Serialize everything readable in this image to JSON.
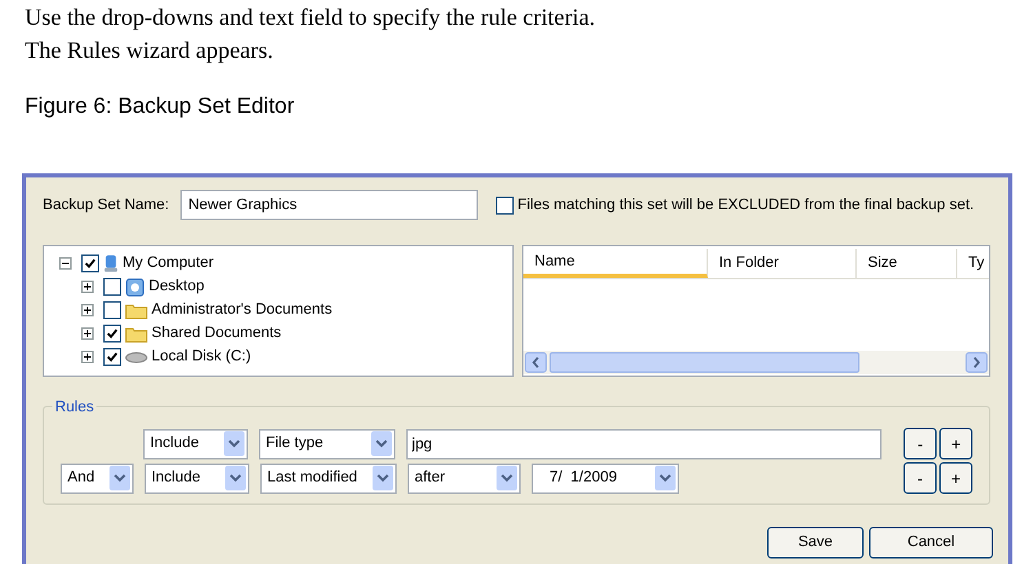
{
  "document": {
    "lines": [
      "Use the drop-downs and text field to specify the rule criteria.",
      "The Rules wizard appears."
    ],
    "caption": "Figure 6: Backup Set Editor"
  },
  "dialog": {
    "name_label": "Backup Set Name:",
    "name_value": "Newer Graphics",
    "exclude": {
      "label": "Files matching this set will be EXCLUDED from the final backup set.",
      "checked": false
    },
    "tree": [
      {
        "label": "My Computer",
        "kind": "computer",
        "checked": true,
        "expanded": true,
        "children": [
          {
            "label": "Desktop",
            "kind": "desktop",
            "checked": false,
            "expanded": false
          },
          {
            "label": "Administrator's Documents",
            "kind": "folder",
            "checked": false,
            "expanded": false
          },
          {
            "label": "Shared Documents",
            "kind": "folder",
            "checked": true,
            "expanded": false
          },
          {
            "label": "Local Disk (C:)",
            "kind": "disk",
            "checked": true,
            "expanded": false
          }
        ]
      }
    ],
    "file_list": {
      "columns": [
        {
          "label": "Name",
          "sorted": true
        },
        {
          "label": "In Folder",
          "sorted": false
        },
        {
          "label": "Size",
          "sorted": false
        },
        {
          "label": "Ty",
          "sorted": false
        }
      ]
    },
    "rules": {
      "title": "Rules",
      "rows": [
        {
          "action": "Include",
          "criterion": "File type",
          "value": {
            "kind": "text",
            "text": "jpg"
          },
          "remove": "-",
          "add": "+"
        },
        {
          "connector": "And",
          "action": "Include",
          "criterion": "Last modified",
          "operator": "after",
          "value": {
            "kind": "date",
            "text": "7/  1/2009"
          },
          "remove": "-",
          "add": "+"
        }
      ]
    },
    "buttons": [
      "Save",
      "Cancel"
    ]
  }
}
